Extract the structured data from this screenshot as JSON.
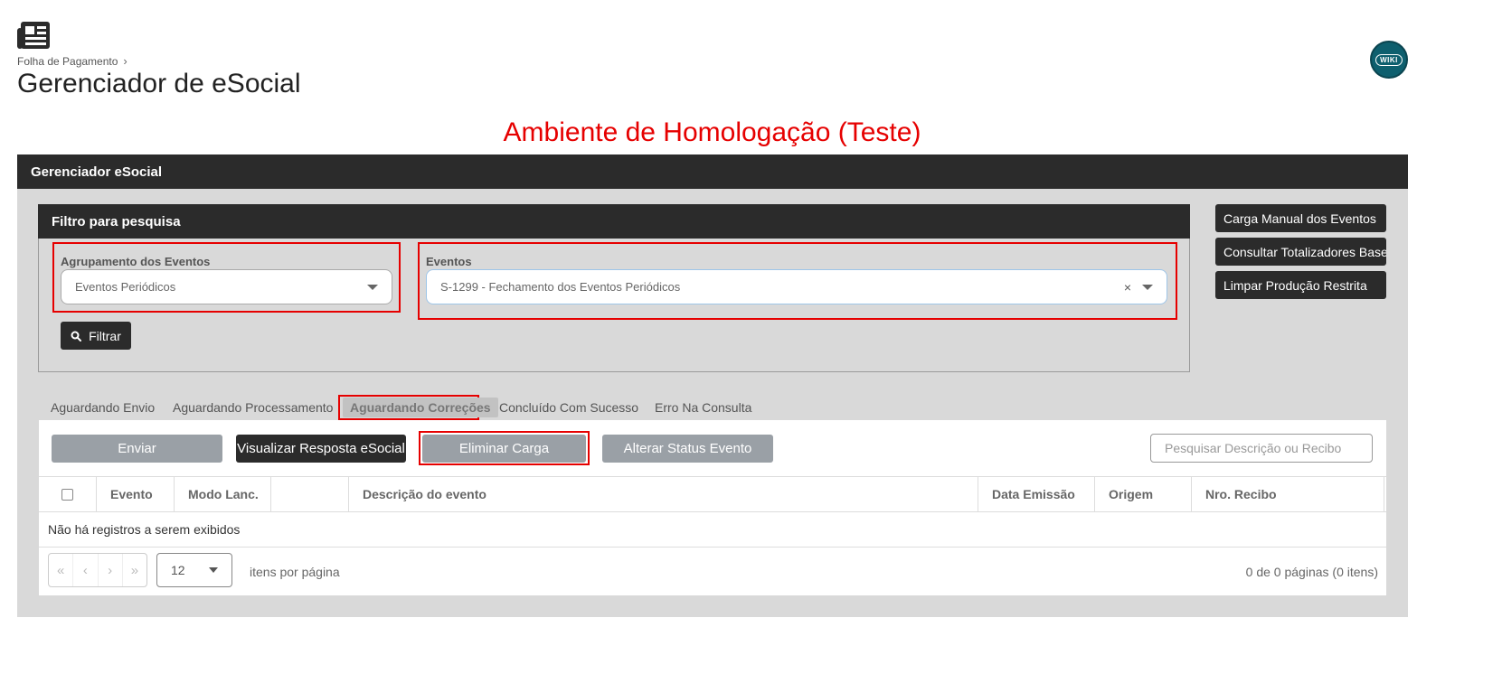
{
  "header": {
    "breadcrumb": "Folha de Pagamento",
    "title": "Gerenciador de eSocial",
    "wiki_label": "WIKI",
    "environment": "Ambiente de Homologação (Teste)"
  },
  "panel": {
    "title": "Gerenciador eSocial"
  },
  "filter": {
    "title": "Filtro para pesquisa",
    "group_label": "Agrupamento dos Eventos",
    "group_value": "Eventos Periódicos",
    "events_label": "Eventos",
    "events_value": "S-1299 - Fechamento dos Eventos Periódicos",
    "clear_symbol": "×",
    "filter_button": "Filtrar"
  },
  "side_buttons": {
    "manual_load": "Carga Manual dos Eventos",
    "totals": "Consultar Totalizadores Base",
    "clear_restricted": "Limpar Produção Restrita"
  },
  "tabs": [
    {
      "label": "Aguardando Envio"
    },
    {
      "label": "Aguardando Processamento"
    },
    {
      "label": "Aguardando Correções"
    },
    {
      "label": "Concluído Com Sucesso"
    },
    {
      "label": "Erro Na Consulta"
    }
  ],
  "toolbar": {
    "send": "Enviar",
    "view_response": "Visualizar Resposta eSocial",
    "delete_load": "Eliminar Carga",
    "change_status": "Alterar Status Evento",
    "search_placeholder": "Pesquisar Descrição ou Recibo"
  },
  "table": {
    "columns": [
      "Evento",
      "Modo Lanc.",
      "",
      "Descrição do evento",
      "Data Emissão",
      "Origem",
      "Nro. Recibo"
    ],
    "empty_message": "Não há registros a serem exibidos"
  },
  "pagination": {
    "first": "«",
    "prev": "‹",
    "next": "›",
    "last": "»",
    "per_page_value": "12",
    "per_page_label": "itens por página",
    "info": "0 de 0 páginas (0 itens)"
  },
  "colors": {
    "dark": "#2b2b2b",
    "panel_bg": "#d9d9d9",
    "highlight_red": "#e60000",
    "gray_button": "#9aa0a6",
    "wiki_teal": "#0e5f6e"
  }
}
